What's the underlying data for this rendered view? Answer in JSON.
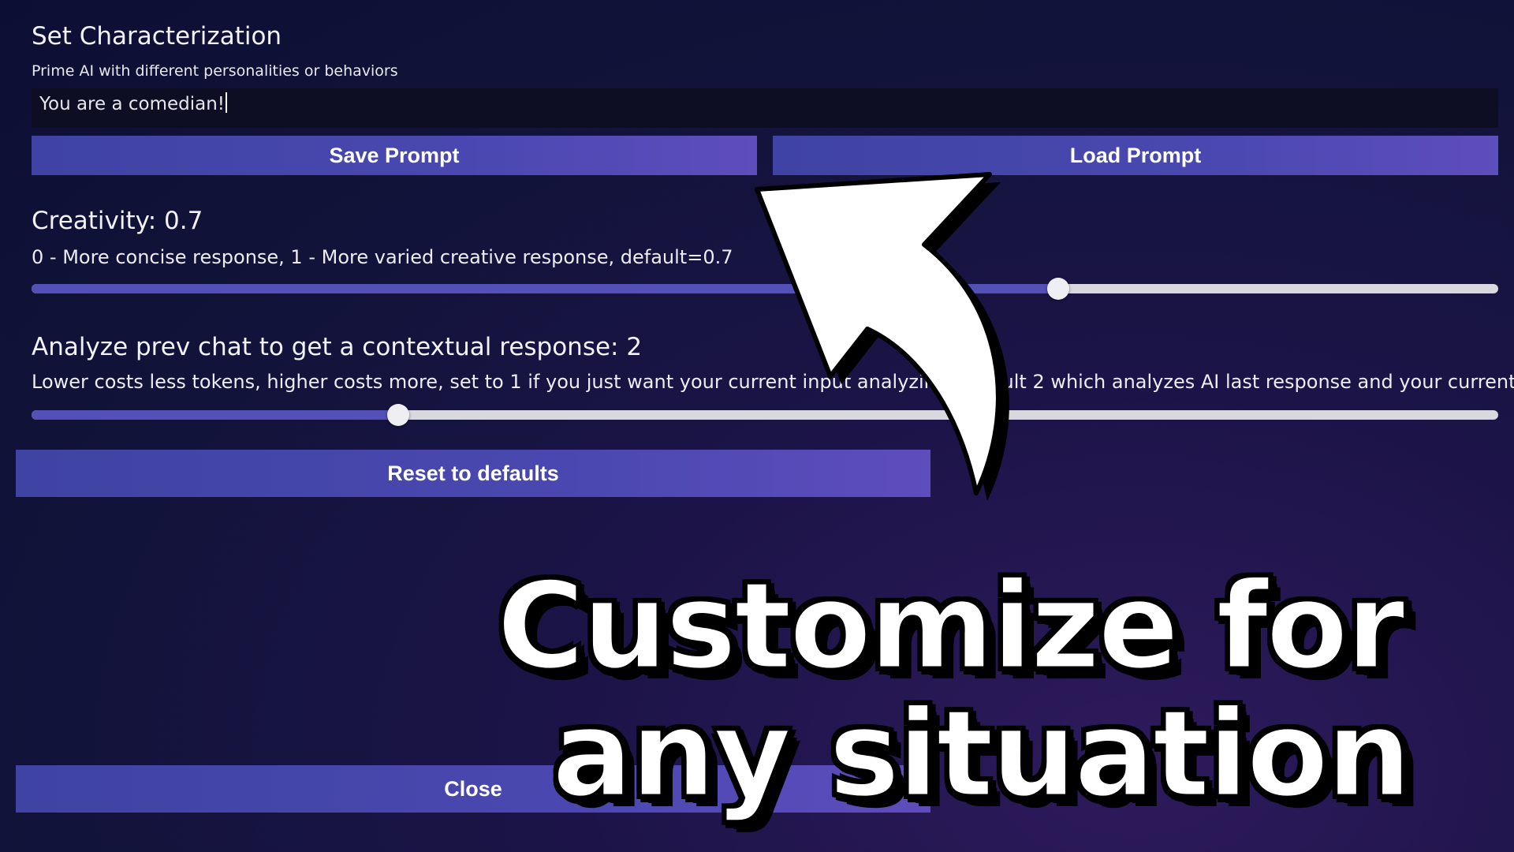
{
  "characterization": {
    "title": "Set Characterization",
    "subtitle": "Prime AI with different personalities or behaviors",
    "input_value": "You are a comedian!"
  },
  "buttons": {
    "save_label": "Save Prompt",
    "load_label": "Load Prompt",
    "reset_label": "Reset to defaults",
    "close_label": "Close"
  },
  "creativity": {
    "label": "Creativity: 0.7",
    "description": "0 - More concise response, 1 - More varied creative response, default=0.7",
    "value": 0.7,
    "min": 0,
    "max": 1
  },
  "context": {
    "label": "Analyze prev chat to get a contextual response: 2",
    "description": "Lower costs less tokens, higher costs more, set to 1 if you just want your current input analyzing, default 2 which analyzes AI last response and your current",
    "value": 2,
    "slider_fraction": 0.25
  },
  "overlay": {
    "line1": "Customize for",
    "line2": "any situation"
  },
  "colors": {
    "button_gradient_start": "#3f43a3",
    "button_gradient_end": "#5e4dbd",
    "slider_fill": "#5350b8",
    "slider_track": "#d8d8de",
    "background": "#111339"
  }
}
